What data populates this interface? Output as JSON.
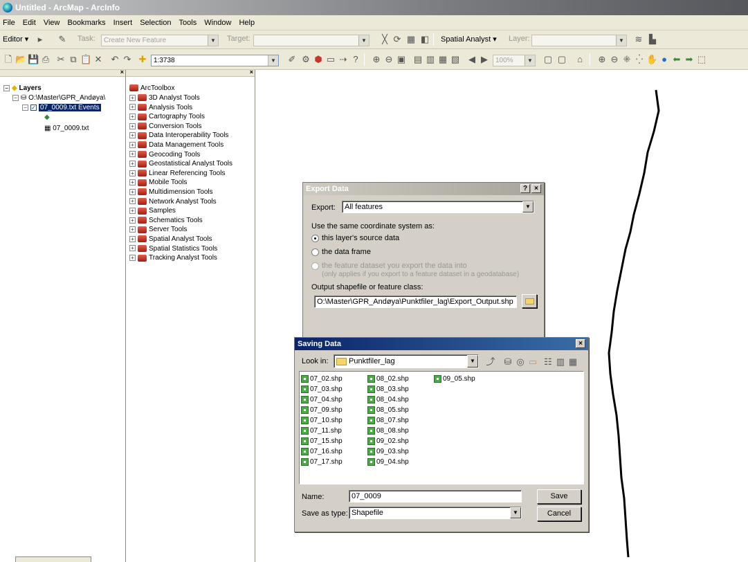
{
  "window": {
    "title": "Untitled - ArcMap - ArcInfo"
  },
  "menu": [
    "File",
    "Edit",
    "View",
    "Bookmarks",
    "Insert",
    "Selection",
    "Tools",
    "Window",
    "Help"
  ],
  "editor_toolbar": {
    "editor_label": "Editor ▾",
    "task_label": "Task:",
    "task_value": "Create New Feature",
    "target_label": "Target:",
    "target_value": "",
    "spatial_analyst_label": "Spatial Analyst ▾",
    "layer_label": "Layer:",
    "layer_value": ""
  },
  "standard_toolbar": {
    "scale_value": "1:3738",
    "zoom_value": "100%"
  },
  "toc": {
    "root": "Layers",
    "db_path": "O:\\Master\\GPR_Andøya\\",
    "layer": "07_0009.txt Events",
    "table": "07_0009.txt"
  },
  "toolbox": {
    "root": "ArcToolbox",
    "items": [
      "3D Analyst Tools",
      "Analysis Tools",
      "Cartography Tools",
      "Conversion Tools",
      "Data Interoperability Tools",
      "Data Management Tools",
      "Geocoding Tools",
      "Geostatistical Analyst Tools",
      "Linear Referencing Tools",
      "Mobile Tools",
      "Multidimension Tools",
      "Network Analyst Tools",
      "Samples",
      "Schematics Tools",
      "Server Tools",
      "Spatial Analyst Tools",
      "Spatial Statistics Tools",
      "Tracking Analyst Tools"
    ]
  },
  "export_dialog": {
    "title": "Export Data",
    "export_label": "Export:",
    "export_value": "All features",
    "coord_label": "Use the same coordinate system as:",
    "opt_source": "this layer's source data",
    "opt_frame": "the data frame",
    "opt_dataset": "the feature dataset you export the data into",
    "opt_dataset_note": "(only applies if you export to a feature dataset in a geodatabase)",
    "output_label": "Output shapefile or feature class:",
    "output_value": "O:\\Master\\GPR_Andøya\\Punktfiler_lag\\Export_Output.shp"
  },
  "save_dialog": {
    "title": "Saving Data",
    "look_in_label": "Look in:",
    "look_in_value": "Punktfiler_lag",
    "files_col1": [
      "07_02.shp",
      "07_03.shp",
      "07_04.shp",
      "07_09.shp",
      "07_10.shp",
      "07_11.shp",
      "07_15.shp",
      "07_16.shp",
      "07_17.shp"
    ],
    "files_col2": [
      "08_02.shp",
      "08_03.shp",
      "08_04.shp",
      "08_05.shp",
      "08_07.shp",
      "08_08.shp",
      "09_02.shp",
      "09_03.shp",
      "09_04.shp"
    ],
    "files_col3": [
      "09_05.shp"
    ],
    "name_label": "Name:",
    "name_value": "07_0009",
    "type_label": "Save as type:",
    "type_value": "Shapefile",
    "save_button": "Save",
    "cancel_button": "Cancel"
  }
}
